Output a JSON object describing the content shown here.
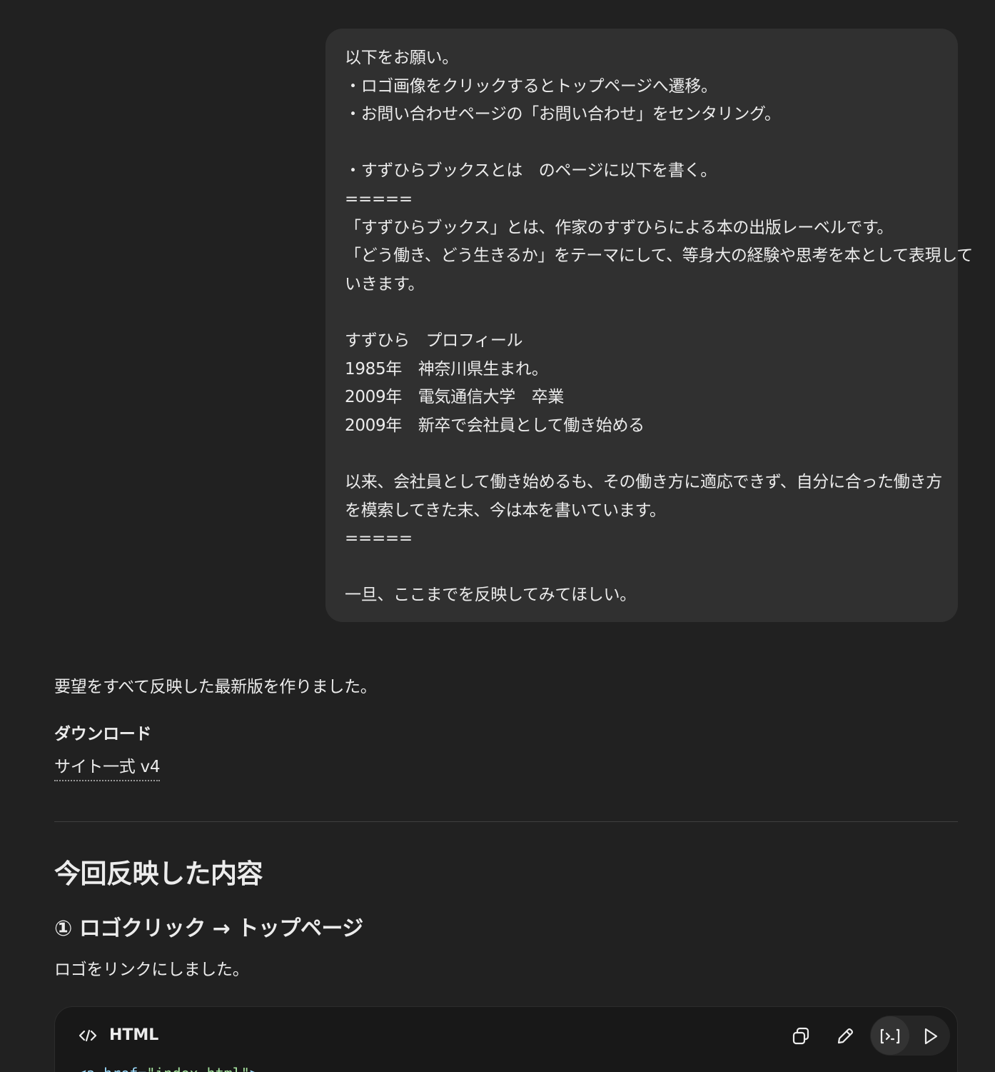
{
  "user_message": {
    "lines": [
      "以下をお願い。",
      "・ロゴ画像をクリックするとトップページへ遷移。",
      "・お問い合わせページの「お問い合わせ」をセンタリング。",
      "",
      "・すずひらブックスとは　のページに以下を書く。",
      "=====",
      "「すずひらブックス」とは、作家のすずひらによる本の出版レーベルです。",
      "「どう働き、どう生きるか」をテーマにして、等身大の経験や思考を本として表現して",
      "いきます。",
      "",
      "すずひら　プロフィール",
      "1985年　神奈川県生まれ。",
      "2009年　電気通信大学　卒業",
      "2009年　新卒で会社員として働き始める",
      "",
      "以来、会社員として働き始めるも、その働き方に適応できず、自分に合った働き方",
      "を模索してきた末、今は本を書いています。",
      "=====",
      "",
      "一旦、ここまでを反映してみてほしい。"
    ]
  },
  "assistant": {
    "intro": "要望をすべて反映した最新版を作りました。",
    "download_heading": "ダウンロード",
    "download_link": "サイト一式 v4",
    "section_title": "今回反映した内容",
    "subsection_title": "① ロゴクリック → トップページ",
    "paragraph": "ロゴをリンクにしました。",
    "code_block": {
      "language": "HTML",
      "code_tag": "<a href=",
      "code_str": "\"index.html\"",
      "code_end": ">"
    }
  },
  "icons": {
    "code_lang": "code-brackets-icon",
    "copy": "copy-icon",
    "edit": "pencil-icon",
    "collapse": "code-collapse-icon",
    "run": "play-icon"
  },
  "colors": {
    "background": "#212121",
    "user_bubble": "#303030",
    "code_background": "#181818",
    "text": "#ececec"
  }
}
